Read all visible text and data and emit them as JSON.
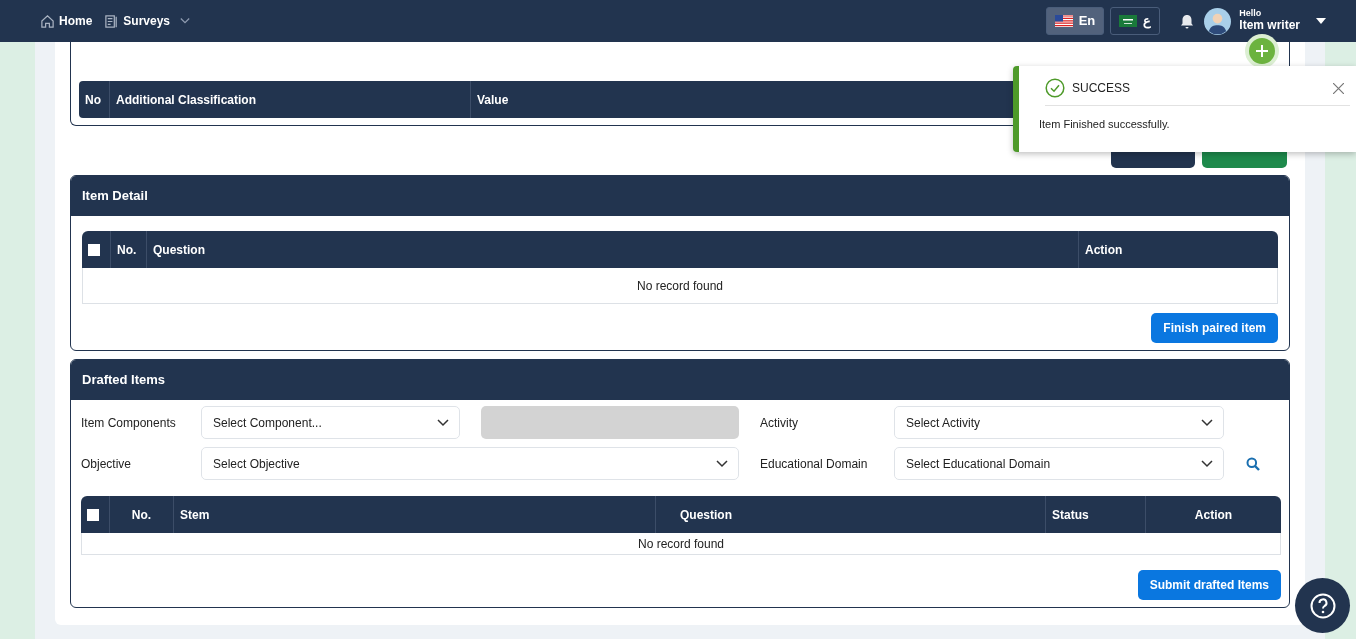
{
  "navbar": {
    "links": [
      {
        "kind": "home",
        "label": "Home",
        "dropdown": false
      },
      {
        "kind": "book",
        "label": "Surveys",
        "dropdown": true
      }
    ],
    "languages": [
      {
        "kind": "us",
        "label": "En",
        "selected": true
      },
      {
        "kind": "sa",
        "label": "ع",
        "selected": false
      }
    ],
    "user": {
      "greeting": "Hello",
      "name": "Item writer"
    }
  },
  "classification": {
    "columns": [
      "No",
      "Additional Classification",
      "Value"
    ]
  },
  "top_actions": [
    {
      "kind": "dark"
    },
    {
      "kind": "green"
    }
  ],
  "item_detail": {
    "title": "Item Detail",
    "select_all": {
      "checked": false
    },
    "columns": [
      "No.",
      "Question",
      "Action"
    ],
    "empty_text": "No record found",
    "button": "Finish paired item"
  },
  "drafted_items": {
    "title": "Drafted Items",
    "filter_rows": [
      [
        {
          "kind": "select",
          "label": "Item Components",
          "placeholder": "Select Component..."
        },
        {
          "kind": "field",
          "disabled": true
        },
        {
          "kind": "select",
          "label": "Activity",
          "placeholder": "Select Activity"
        }
      ],
      [
        {
          "kind": "select",
          "label": "Objective",
          "placeholder": "Select Objective"
        },
        {
          "kind": "select",
          "label": "Educational Domain",
          "placeholder": "Select Educational Domain"
        },
        {
          "kind": "search"
        }
      ]
    ],
    "select_all": {
      "checked": false
    },
    "columns": [
      "No.",
      "Stem",
      "Question",
      "Status",
      "Action"
    ],
    "empty_text": "No record found",
    "button": "Submit drafted Items"
  },
  "toast": {
    "title": "SUCCESS",
    "message": "Item Finished successfully."
  }
}
